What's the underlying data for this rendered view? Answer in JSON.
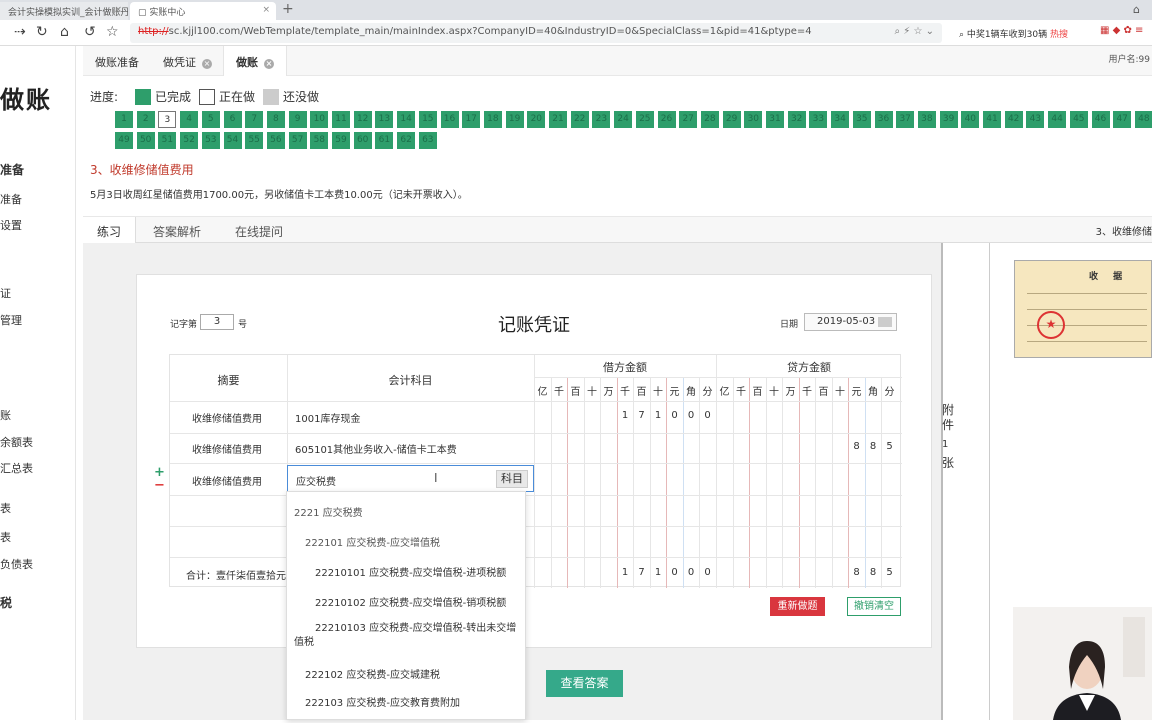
{
  "browser": {
    "tab1_title": "会计实操模拟实训_会计做账丹",
    "tab2_title": "实账中心",
    "url_scheme": "http://",
    "url_rest": "sc.kjjl100.com/WebTemplate/template_main/mainIndex.aspx?CompanyID=40&IndustryID=0&SpecialClass=1&pid=41&ptype=4",
    "search_text": "中奖1辆车收到30辆",
    "search_hot": "热搜"
  },
  "sidebar": {
    "logo": "做账",
    "items": [
      "准备",
      "准备",
      "设置",
      "",
      "证",
      "管理",
      "",
      "",
      "账",
      "余额表",
      "汇总表",
      "表",
      "表",
      "负债表",
      "税"
    ]
  },
  "subtabs": [
    "做账准备",
    "做凭证",
    "做账"
  ],
  "user_label": "用户名:99",
  "progress": {
    "label": "进度:",
    "legend_done": "已完成",
    "legend_doing": "正在做",
    "legend_todo": "还没做",
    "current": 3,
    "total": 63
  },
  "question": {
    "title": "3、收维修储值费用",
    "desc": "5月3日收周红星储值费用1700.00元，另收储值卡工本费10.00元（记未开票收入）。"
  },
  "lower_tabs": [
    "练习",
    "答案解析",
    "在线提问"
  ],
  "right_title": "3、收维修储",
  "voucher": {
    "no_label": "记字第",
    "no": "3",
    "hao": "号",
    "title": "记账凭证",
    "date_label": "日期",
    "date": "2019-05-03",
    "col_summary": "摘要",
    "col_subject": "会计科目",
    "col_debit": "借方金额",
    "col_credit": "贷方金额",
    "units": [
      "亿",
      "千",
      "百",
      "十",
      "万",
      "千",
      "百",
      "十",
      "元",
      "角",
      "分"
    ],
    "rows": [
      {
        "summary": "收维修储值费用",
        "subject": "1001库存现金"
      },
      {
        "summary": "收维修储值费用",
        "subject": "605101其他业务收入-储值卡工本费"
      },
      {
        "summary": "收维修储值费用",
        "subject": "应交税费"
      }
    ],
    "row1_debit_digits": [
      "1",
      "7",
      "1",
      "0",
      "0",
      "0"
    ],
    "row2_credit_digits": [
      "8",
      "8",
      "5"
    ],
    "total_label": "合计：壹仟柒佰壹拾元",
    "total_debit_digits": [
      "1",
      "7",
      "1",
      "0",
      "0",
      "0"
    ],
    "total_credit_digits": [
      "8",
      "8",
      "5"
    ],
    "subject_btn": "科目",
    "redo_btn": "重新做题",
    "clear_btn": "撤销清空"
  },
  "attachment": {
    "label1": "附",
    "label2": "件",
    "count": "1",
    "label3": "张"
  },
  "receipt": {
    "title": "收  据"
  },
  "dropdown": [
    {
      "code": "2221",
      "name": "应交税费"
    },
    {
      "code": "222101",
      "name": "应交税费-应交增值税"
    },
    {
      "code": "22210101",
      "name": "应交税费-应交增值税-进项税额"
    },
    {
      "code": "22210102",
      "name": "应交税费-应交增值税-销项税额"
    },
    {
      "code": "22210103",
      "name": "应交税费-应交增值税-转出未交增值税"
    },
    {
      "code": "222102",
      "name": "应交税费-应交城建税"
    },
    {
      "code": "222103",
      "name": "应交税费-应交教育费附加"
    }
  ],
  "view_answer": "查看答案"
}
